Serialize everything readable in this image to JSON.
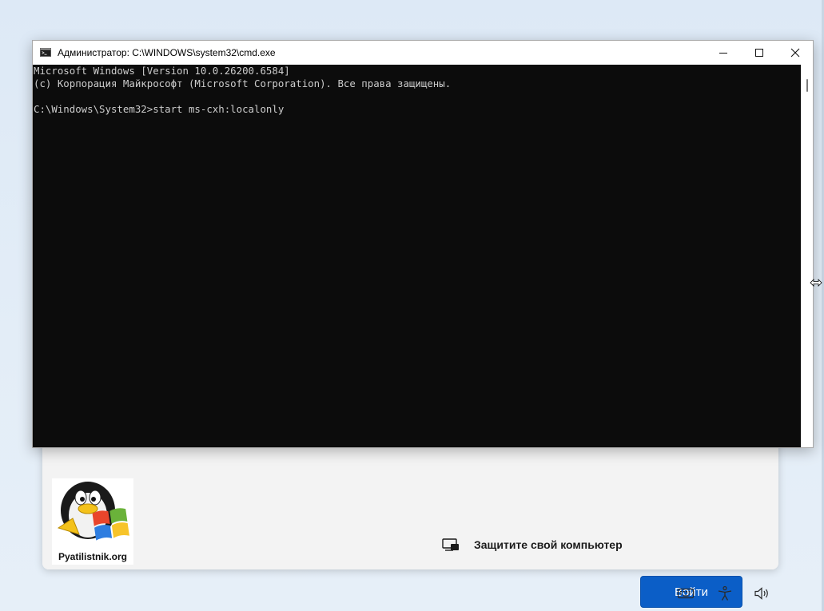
{
  "window": {
    "title": "Администратор: C:\\WINDOWS\\system32\\cmd.exe",
    "icon": "cmd-icon",
    "controls": [
      "minimize-icon",
      "maximize-icon",
      "close-icon"
    ]
  },
  "console": {
    "lines": [
      "Microsoft Windows [Version 10.0.26200.6584]",
      "(с) Корпорация Майкрософт (Microsoft Corporation). Все права защищены.",
      "",
      "C:\\Windows\\System32>start ms-cxh:localonly"
    ]
  },
  "oobe": {
    "protect_text": "Защитите свой компьютер",
    "protect_icon": "device-shield-icon",
    "signin_label": "Войти",
    "accent": "#0b5ec7"
  },
  "logo": {
    "text": "Pyatilistnik.org"
  },
  "tray": {
    "icons": [
      "keyboard-icon",
      "accessibility-icon",
      "volume-icon"
    ]
  },
  "colors": {
    "console_bg": "#0c0c0c",
    "console_fg": "#cccccc"
  }
}
